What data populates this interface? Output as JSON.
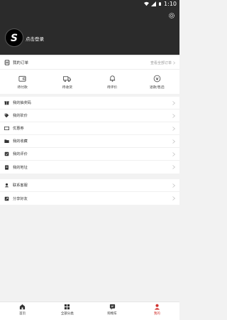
{
  "status_bar": {
    "time": "1:10"
  },
  "profile": {
    "login_text": "点击登录",
    "avatar_letter": "S"
  },
  "orders": {
    "title": "我的订单",
    "view_all": "查看全部订单",
    "items": [
      {
        "label": "待付款",
        "icon": "wallet-icon"
      },
      {
        "label": "待收货",
        "icon": "truck-icon"
      },
      {
        "label": "待评价",
        "icon": "bell-icon"
      },
      {
        "label": "退款/售后",
        "icon": "refund-icon"
      }
    ]
  },
  "menu_group_1": [
    {
      "label": "我的抽奖码",
      "icon": "gift-icon"
    },
    {
      "label": "我的砍价",
      "icon": "tag-icon"
    },
    {
      "label": "优惠券",
      "icon": "coupon-icon"
    },
    {
      "label": "我的收藏",
      "icon": "folder-icon"
    },
    {
      "label": "我的评价",
      "icon": "review-icon"
    },
    {
      "label": "我的地址",
      "icon": "address-icon"
    }
  ],
  "menu_group_2": [
    {
      "label": "联系客服",
      "icon": "service-icon"
    },
    {
      "label": "分享好友",
      "icon": "share-icon"
    }
  ],
  "tabbar": [
    {
      "label": "首页",
      "icon": "home-icon"
    },
    {
      "label": "全部分类",
      "icon": "category-icon"
    },
    {
      "label": "购物车",
      "icon": "cart-icon"
    },
    {
      "label": "我的",
      "icon": "user-icon",
      "active": true
    }
  ],
  "colors": {
    "header": "#2b2b2b",
    "accent": "#d0312d"
  }
}
